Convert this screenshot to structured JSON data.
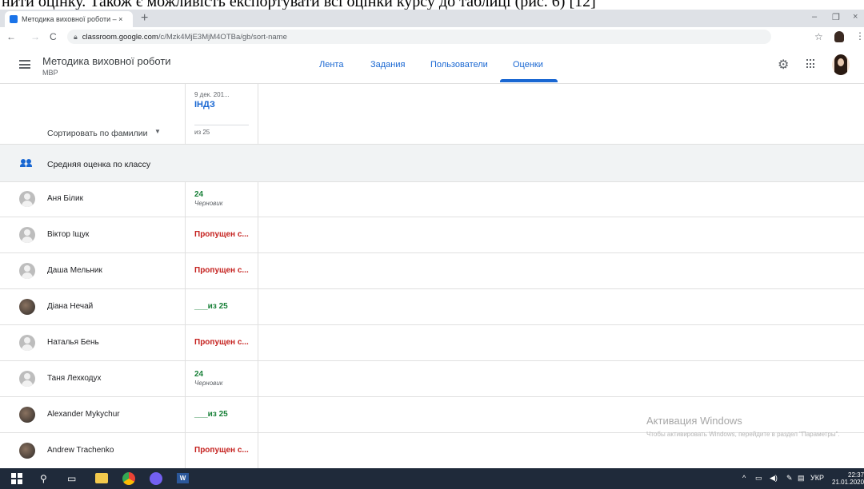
{
  "document_snippet": "нити оцінку. Також є можливість експортувати всі оцінки курсу до таблиці (рис. 6) [12]",
  "browser": {
    "tab_title": "Методика виховної роботи – ×",
    "tab_close": "×",
    "new_tab": "+",
    "minimize": "–",
    "restore": "❐",
    "close": "×",
    "back": "←",
    "forward": "→",
    "reload": "C",
    "url_host": "classroom.google.com",
    "url_path": "/c/Mzk4MjE3MjM4OTBa/gb/sort-name",
    "star": "☆",
    "kebab": "⋮"
  },
  "header": {
    "course_title": "Методика виховної роботи",
    "course_subtitle": "МВР",
    "tabs": [
      {
        "label": "Лента"
      },
      {
        "label": "Задания"
      },
      {
        "label": "Пользователи"
      },
      {
        "label": "Оценки"
      }
    ],
    "active_tab": "Оценки"
  },
  "assignment": {
    "date": "9 дек. 201...",
    "title": "ІНДЗ",
    "max_points": "из 25"
  },
  "sort": {
    "label": "Сортировать по фамилии",
    "arrow": "▼"
  },
  "class_average": {
    "label": "Средняя оценка по классу",
    "value": ""
  },
  "students": [
    {
      "name": "Аня Білик",
      "grade": "24",
      "status": "Черновик",
      "grade_color": "green",
      "avatar": "default"
    },
    {
      "name": "Віктор Іщук",
      "grade": "Пропущен с...",
      "status": "",
      "grade_color": "red",
      "avatar": "default"
    },
    {
      "name": "Даша Мельник",
      "grade": "Пропущен с...",
      "status": "",
      "grade_color": "red",
      "avatar": "default"
    },
    {
      "name": "Діана Нечай",
      "grade": "___из 25",
      "status": "",
      "grade_color": "green",
      "avatar": "photo"
    },
    {
      "name": "Наталья Бень",
      "grade": "Пропущен с...",
      "status": "",
      "grade_color": "red",
      "avatar": "default"
    },
    {
      "name": "Таня Лехкодух",
      "grade": "24",
      "status": "Черновик",
      "grade_color": "green",
      "avatar": "default"
    },
    {
      "name": "Alexander Mykychur",
      "grade": "___из 25",
      "status": "",
      "grade_color": "green",
      "avatar": "photo"
    },
    {
      "name": "Andrew Trachenko",
      "grade": "Пропущен с...",
      "status": "",
      "grade_color": "red",
      "avatar": "photo"
    }
  ],
  "watermark": {
    "title": "Активация Windows",
    "text": "Чтобы активировать Windows, перейдите в раздел \"Параметры\"."
  },
  "taskbar": {
    "language": "УКР",
    "time": "22:37",
    "date": "21.01.2020",
    "word_label": "W"
  },
  "colors": {
    "accent": "#1967d2",
    "grade_green": "#188038",
    "grade_red": "#c5221f"
  }
}
